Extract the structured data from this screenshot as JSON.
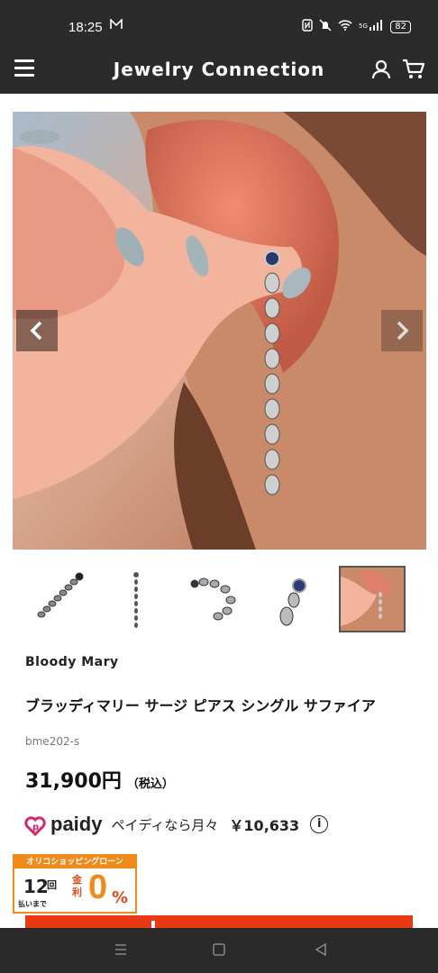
{
  "status_bar": {
    "time": "18:25",
    "battery": "82",
    "icons": [
      "mail-m-icon",
      "nfc-icon",
      "mute-icon",
      "wifi-icon",
      "signal-icon",
      "battery-icon"
    ]
  },
  "header": {
    "title": "Jewelry Connection",
    "icons": [
      "menu-icon",
      "user-icon",
      "cart-icon"
    ]
  },
  "gallery": {
    "prev_icon": "chevron-left-icon",
    "next_icon": "chevron-right-icon",
    "thumbnails": [
      "earring-flat",
      "earring-vertical",
      "earring-curled",
      "earring-closeup",
      "earring-worn"
    ],
    "active_thumbnail": 4
  },
  "product": {
    "brand": "Bloody Mary",
    "name": "ブラッディマリー サージ ピアス シングル サファイア",
    "sku": "bme202-s",
    "price": "31,900円",
    "price_tax": "（税込）"
  },
  "paidy": {
    "logo": "paidy",
    "text": "ペイディなら月々",
    "amount": "￥10,633",
    "info": "i"
  },
  "orico": {
    "header": "オリコショッピングローン",
    "count": "12",
    "count_unit": "回",
    "sub": "払いまで",
    "kinri": "金利",
    "rate": "0",
    "percent": "%"
  },
  "colors": {
    "header_bg": "#2b2b2b",
    "accent_red": "#e83a14",
    "orico_orange": "#f08a1a",
    "paidy_magenta": "#d6246e"
  }
}
